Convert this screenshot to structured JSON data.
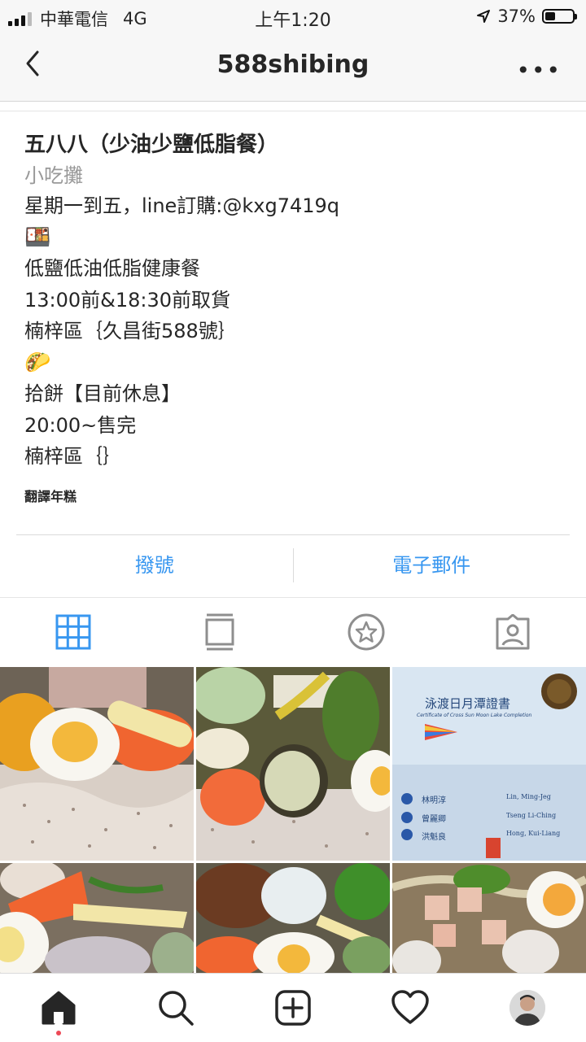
{
  "status_bar": {
    "carrier": "中華電信",
    "network": "4G",
    "time": "上午1:20",
    "battery": "37%"
  },
  "header": {
    "title": "588shibing",
    "more": "•••"
  },
  "profile": {
    "name": "五八八（少油少鹽低脂餐）",
    "category": "小吃攤",
    "bio_lines": [
      "星期一到五，line訂購:@kxg7419q",
      "🍱",
      "低鹽低油低脂健康餐",
      "13:00前&18:30前取貨",
      "楠梓區｛久昌街588號｝",
      "🌮",
      "拾餅【目前休息】",
      "20:00~售完",
      "楠梓區｛｝"
    ],
    "translate": "翻譯年糕"
  },
  "actions": {
    "call": "撥號",
    "email": "電子郵件"
  },
  "tabs": {
    "icons": [
      "grid-icon",
      "feed-icon",
      "star-icon",
      "tagged-icon"
    ],
    "active_color": "#3897f0"
  },
  "grid": {
    "certificate": {
      "title": "泳渡日月潭證書",
      "subtitle": "Certificate of Cross Sun Moon Lake Completion",
      "name_zh": "林明淳",
      "name_en": "Lin, Ming-Jeg",
      "name2_zh": "曾麗卿",
      "name2_en": "Tseng Li-Ching",
      "name3_zh": "洪魁良",
      "name3_en": "Hong, Kui-Liang"
    }
  },
  "bottom_nav": {
    "icons": [
      "home-icon",
      "search-icon",
      "add-post-icon",
      "activity-heart-icon",
      "profile-avatar"
    ]
  }
}
